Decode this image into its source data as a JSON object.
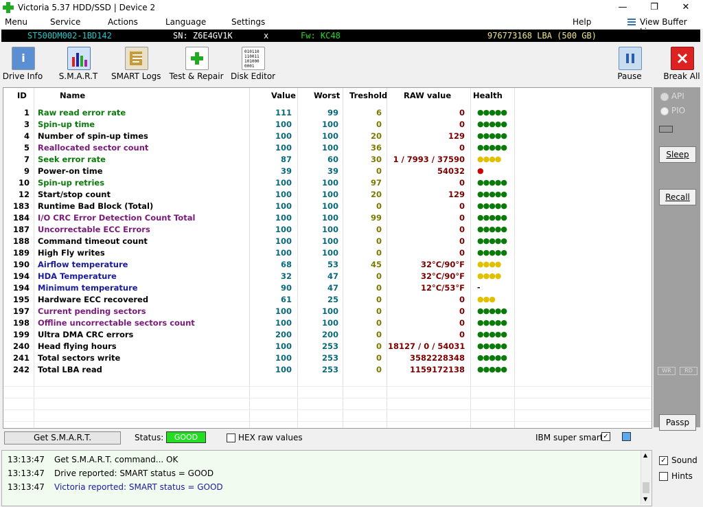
{
  "window": {
    "title": "Victoria 5.37 HDD/SSD | Device 2",
    "minimize": "—",
    "maximize": "❐",
    "close": "✕"
  },
  "menu": {
    "items": [
      "Menu",
      "Service",
      "Actions",
      "Language",
      "Settings",
      "Help"
    ],
    "view_buffer": "View Buffer Live"
  },
  "drive": {
    "model": "ST500DM002-1BD142",
    "serial": "SN: Z6E4GV1K",
    "x": "x",
    "firmware": "Fw: KC48",
    "lba": "976773168 LBA (500 GB)"
  },
  "toolbar": {
    "drive_info": "Drive Info",
    "smart": "S.M.A.R.T",
    "smart_logs": "SMART Logs",
    "test_repair": "Test & Repair",
    "disk_editor": "Disk Editor",
    "pause": "Pause",
    "break_all": "Break All",
    "disk_editor_icon_text": "010110\n110011\n101000\n0001"
  },
  "table": {
    "columns": [
      "ID",
      "Name",
      "Value",
      "Worst",
      "Treshold",
      "RAW value",
      "Health"
    ],
    "rows": [
      {
        "id": "1",
        "name": "Raw read error rate",
        "value": "111",
        "worst": "99",
        "thr": "6",
        "raw": "0",
        "health": "●●●●●",
        "nc": "#0a7a0a",
        "hc": "#0a7a0a"
      },
      {
        "id": "3",
        "name": "Spin-up time",
        "value": "100",
        "worst": "100",
        "thr": "0",
        "raw": "0",
        "health": "●●●●●",
        "nc": "#0a7a0a",
        "hc": "#0a7a0a"
      },
      {
        "id": "4",
        "name": "Number of spin-up times",
        "value": "100",
        "worst": "100",
        "thr": "20",
        "raw": "129",
        "health": "●●●●●",
        "nc": "#000000",
        "hc": "#0a7a0a"
      },
      {
        "id": "5",
        "name": "Reallocated sector count",
        "value": "100",
        "worst": "100",
        "thr": "36",
        "raw": "0",
        "health": "●●●●●",
        "nc": "#7a1a7a",
        "hc": "#0a7a0a"
      },
      {
        "id": "7",
        "name": "Seek error rate",
        "value": "87",
        "worst": "60",
        "thr": "30",
        "raw": "1 / 7993 / 37590",
        "health": "●●●●",
        "nc": "#0a7a0a",
        "hc": "#e0c000"
      },
      {
        "id": "9",
        "name": "Power-on time",
        "value": "39",
        "worst": "39",
        "thr": "0",
        "raw": "54032",
        "health": "●",
        "nc": "#000000",
        "hc": "#cc0000"
      },
      {
        "id": "10",
        "name": "Spin-up retries",
        "value": "100",
        "worst": "100",
        "thr": "97",
        "raw": "0",
        "health": "●●●●●",
        "nc": "#0a7a0a",
        "hc": "#0a7a0a"
      },
      {
        "id": "12",
        "name": "Start/stop count",
        "value": "100",
        "worst": "100",
        "thr": "20",
        "raw": "129",
        "health": "●●●●●",
        "nc": "#000000",
        "hc": "#0a7a0a"
      },
      {
        "id": "183",
        "name": "Runtime Bad Block (Total)",
        "value": "100",
        "worst": "100",
        "thr": "0",
        "raw": "0",
        "health": "●●●●●",
        "nc": "#000000",
        "hc": "#0a7a0a"
      },
      {
        "id": "184",
        "name": "I/O CRC Error Detection Count Total",
        "value": "100",
        "worst": "100",
        "thr": "99",
        "raw": "0",
        "health": "●●●●●",
        "nc": "#7a1a7a",
        "hc": "#0a7a0a"
      },
      {
        "id": "187",
        "name": "Uncorrectable ECC Errors",
        "value": "100",
        "worst": "100",
        "thr": "0",
        "raw": "0",
        "health": "●●●●●",
        "nc": "#7a1a7a",
        "hc": "#0a7a0a"
      },
      {
        "id": "188",
        "name": "Command timeout count",
        "value": "100",
        "worst": "100",
        "thr": "0",
        "raw": "0",
        "health": "●●●●●",
        "nc": "#000000",
        "hc": "#0a7a0a"
      },
      {
        "id": "189",
        "name": "High Fly writes",
        "value": "100",
        "worst": "100",
        "thr": "0",
        "raw": "0",
        "health": "●●●●●",
        "nc": "#000000",
        "hc": "#0a7a0a"
      },
      {
        "id": "190",
        "name": "Airflow temperature",
        "value": "68",
        "worst": "53",
        "thr": "45",
        "raw": "32°C/90°F",
        "health": "●●●●",
        "nc": "#1a1a9a",
        "hc": "#e0c000"
      },
      {
        "id": "194",
        "name": "HDA Temperature",
        "value": "32",
        "worst": "47",
        "thr": "0",
        "raw": "32°C/90°F",
        "health": "●●●●",
        "nc": "#1a1a9a",
        "hc": "#e0c000"
      },
      {
        "id": "194",
        "name": "Minimum temperature",
        "value": "90",
        "worst": "47",
        "thr": "0",
        "raw": "12°C/53°F",
        "health": "-",
        "nc": "#1a1a9a",
        "hc": "#000000"
      },
      {
        "id": "195",
        "name": "Hardware ECC recovered",
        "value": "61",
        "worst": "25",
        "thr": "0",
        "raw": "0",
        "health": "●●●",
        "nc": "#000000",
        "hc": "#e0c000"
      },
      {
        "id": "197",
        "name": "Current pending sectors",
        "value": "100",
        "worst": "100",
        "thr": "0",
        "raw": "0",
        "health": "●●●●●",
        "nc": "#7a1a7a",
        "hc": "#0a7a0a"
      },
      {
        "id": "198",
        "name": "Offline uncorrectable sectors count",
        "value": "100",
        "worst": "100",
        "thr": "0",
        "raw": "0",
        "health": "●●●●●",
        "nc": "#7a1a7a",
        "hc": "#0a7a0a"
      },
      {
        "id": "199",
        "name": "Ultra DMA CRC errors",
        "value": "200",
        "worst": "200",
        "thr": "0",
        "raw": "0",
        "health": "●●●●●",
        "nc": "#000000",
        "hc": "#0a7a0a"
      },
      {
        "id": "240",
        "name": "Head flying hours",
        "value": "100",
        "worst": "253",
        "thr": "0",
        "raw": "18127 / 0 / 54031",
        "health": "●●●●●",
        "nc": "#000000",
        "hc": "#0a7a0a"
      },
      {
        "id": "241",
        "name": "Total sectors write",
        "value": "100",
        "worst": "253",
        "thr": "0",
        "raw": "3582228348",
        "health": "●●●●●",
        "nc": "#000000",
        "hc": "#0a7a0a"
      },
      {
        "id": "242",
        "name": "Total LBA read",
        "value": "100",
        "worst": "253",
        "thr": "0",
        "raw": "1159172138",
        "health": "●●●●●",
        "nc": "#000000",
        "hc": "#0a7a0a"
      }
    ]
  },
  "right_panel": {
    "api": "API",
    "pio": "PIO",
    "sleep": "Sleep",
    "recall": "Recall",
    "wr": "WR",
    "rd": "RD",
    "passp": "Passp"
  },
  "status_bar": {
    "get_smart": "Get S.M.A.R.T.",
    "status_label": "Status:",
    "status_value": "GOOD",
    "hex_raw": "HEX raw values",
    "ibm_super_smart": "IBM super smart:",
    "check": "✓"
  },
  "log": [
    {
      "time": "13:13:47",
      "msg": "Get S.M.A.R.T. command... OK",
      "color": "#000000"
    },
    {
      "time": "13:13:47",
      "msg": "Drive reported: SMART status = GOOD",
      "color": "#000000"
    },
    {
      "time": "13:13:47",
      "msg": "Victoria reported: SMART status = GOOD",
      "color": "#1a1aa0"
    }
  ],
  "options": {
    "sound": "Sound",
    "hints": "Hints",
    "check": "✓"
  },
  "colors": {
    "accent_green": "#2db52d",
    "status_good": "#22dd22",
    "drive_bar_bg": "#000000",
    "value_teal": "#0a6a7a",
    "threshold_olive": "#7a7a00",
    "raw_maroon": "#7a0000"
  }
}
